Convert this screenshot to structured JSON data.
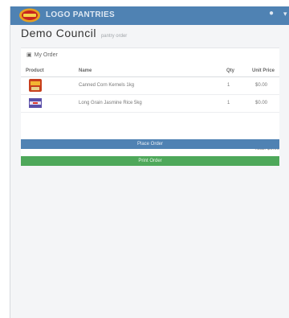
{
  "navbar": {
    "brand": "LOGO PANTRIES",
    "user_icon": "user-icon",
    "caret_icon": "caret-down-icon",
    "color": "#4f82b3"
  },
  "header": {
    "title": "Demo Council",
    "subtitle": "pantry order"
  },
  "order": {
    "label": "My Order",
    "columns": [
      "Product",
      "Name",
      "Qty",
      "Unit Price"
    ],
    "items": [
      {
        "thumb": "product-thumbnail",
        "name": "Canned Corn Kernels 1kg",
        "qty": "1",
        "price": "$0.00"
      },
      {
        "thumb": "product-thumbnail",
        "name": "Long Grain Jasmine Rice 5kg",
        "qty": "1",
        "price": "$0.00"
      }
    ],
    "total": "Total: $0.00"
  },
  "actions": {
    "primary_label": "Place Order",
    "success_label": "Print Order",
    "primary_color": "#4f82b3",
    "success_color": "#4ea85a"
  }
}
